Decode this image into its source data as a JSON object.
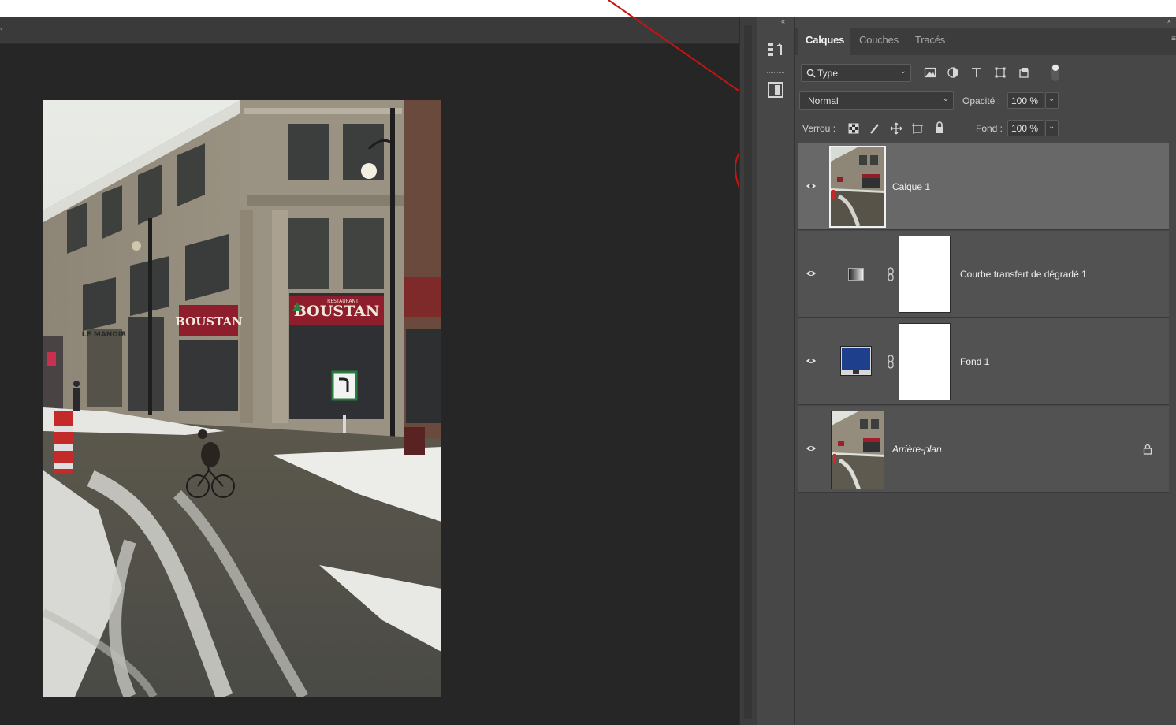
{
  "panel": {
    "tabs": [
      {
        "label": "Calques",
        "active": true
      },
      {
        "label": "Couches",
        "active": false
      },
      {
        "label": "Tracés",
        "active": false
      }
    ],
    "filter": {
      "label": "Type",
      "icon": "search-icon"
    },
    "blend_mode": "Normal",
    "opacity_label": "Opacité :",
    "opacity_value": "100 %",
    "lock_label": "Verrou :",
    "fill_label": "Fond :",
    "fill_value": "100 %"
  },
  "layers": [
    {
      "name": "Calque 1",
      "selected": true,
      "italic": false
    },
    {
      "name": "Courbe transfert de dégradé 1",
      "selected": false,
      "italic": false
    },
    {
      "name": "Fond 1",
      "selected": false,
      "italic": false,
      "swatch_color": "#1e3f8c"
    },
    {
      "name": "Arrière-plan",
      "selected": false,
      "italic": true,
      "locked": true
    }
  ],
  "photo": {
    "sign_text": "BOUSTAN",
    "sign_small": "RESTAURANT",
    "sign_left": "BOUSTAN",
    "le_manoir": "LE MANOIR"
  },
  "colors": {
    "annotation_red": "#cc1111",
    "panel_bg": "#474747",
    "selected_row": "#686868"
  }
}
